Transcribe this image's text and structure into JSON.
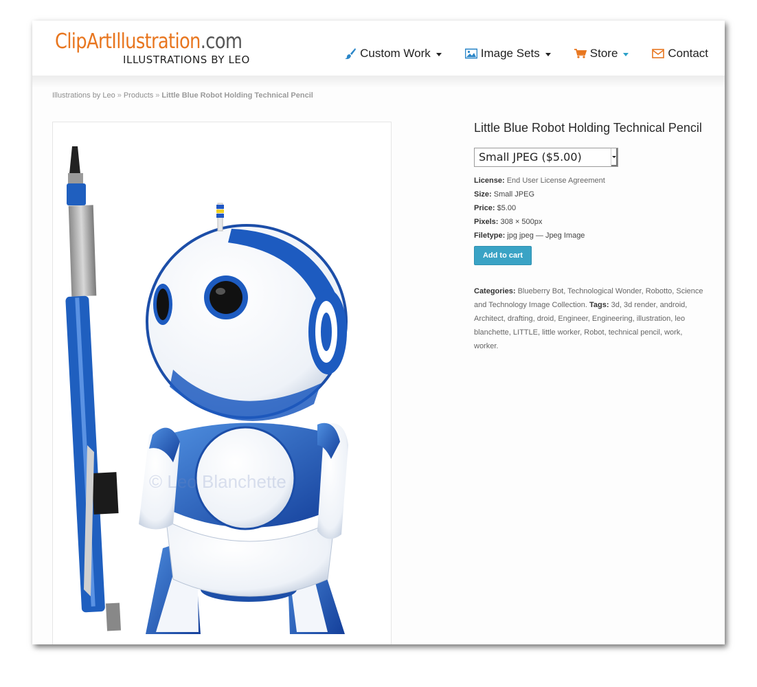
{
  "site": {
    "logo_brand": "ClipArtIllustration",
    "logo_tld": ".com",
    "logo_tagline": "ILLUSTRATIONS BY LEO"
  },
  "nav": [
    {
      "label": "Custom Work",
      "icon": "paintbrush-icon",
      "has_caret": true
    },
    {
      "label": "Image Sets",
      "icon": "picture-icon",
      "has_caret": true
    },
    {
      "label": "Store",
      "icon": "shopping-cart-icon",
      "has_caret": true
    },
    {
      "label": "Contact",
      "icon": "envelope-icon",
      "has_caret": false
    }
  ],
  "breadcrumb": {
    "home": "Illustrations by Leo",
    "separator": "»",
    "section": "Products",
    "current": "Little Blue Robot Holding Technical Pencil"
  },
  "product": {
    "title": "Little Blue Robot Holding Technical Pencil",
    "watermark": "© Leo Blanchette",
    "variant_selected": "Small JPEG ($5.00)",
    "meta": {
      "license_label": "License:",
      "license_value": "End User License Agreement",
      "size_label": "Size:",
      "size_value": "Small JPEG",
      "price_label": "Price:",
      "price_value": "$5.00",
      "pixels_label": "Pixels:",
      "pixels_value": "308 × 500px",
      "filetype_label": "Filetype:",
      "filetype_value": "jpg jpeg — Jpeg Image"
    },
    "add_to_cart_label": "Add to cart",
    "categories_label": "Categories:",
    "categories": [
      "Blueberry Bot",
      "Technological Wonder",
      "Robotto",
      "Science and Technology Image Collection"
    ],
    "tags_label": "Tags:",
    "tags": [
      "3d",
      "3d render",
      "android",
      "Architect",
      "drafting",
      "droid",
      "Engineer",
      "Engineering",
      "illustration",
      "leo blanchette",
      "LITTLE",
      "little worker",
      "Robot",
      "technical pencil",
      "work",
      "worker"
    ]
  },
  "colors": {
    "brand_orange": "#e8761f",
    "nav_blue": "#2a86c8",
    "cart_button": "#3aa3c5",
    "robot_blue": "#1f5fbf"
  }
}
